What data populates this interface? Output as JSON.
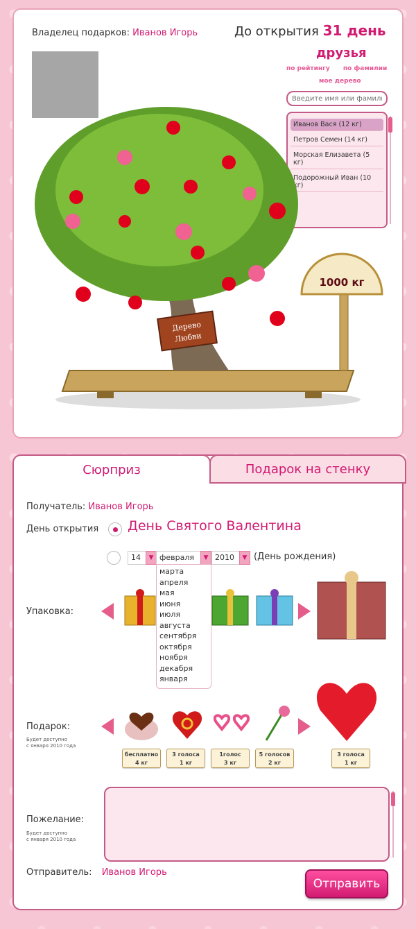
{
  "top": {
    "owner_label": "Владелец подарков:",
    "owner_name": "Иванов Игорь",
    "countdown_label": "До открытия",
    "countdown_value": "31 день",
    "friends": {
      "title": "друзья",
      "sort_by_rating": "по рейтингу",
      "sort_by_surname": "по фамилии",
      "my_tree": "мое дерево",
      "search_placeholder": "Введите имя или фамилию",
      "items": [
        {
          "label": "Иванов Вася (12 кг)",
          "selected": true
        },
        {
          "label": "Петров Семен (14 кг)",
          "selected": false
        },
        {
          "label": "Морская Елизавета (5 кг)",
          "selected": false
        },
        {
          "label": "Подорожный Иван (10 кг)",
          "selected": false
        }
      ]
    },
    "tree": {
      "sign_line1": "Дерево",
      "sign_line2": "Любви",
      "scale_weight": "1000 кг"
    }
  },
  "bottom": {
    "tabs": [
      {
        "label": "Сюрприз",
        "active": true
      },
      {
        "label": "Подарок на стенку",
        "active": false
      }
    ],
    "recipient_label": "Получатель:",
    "recipient_name": "Иванов Игорь",
    "open_day_label": "День открытия",
    "holiday": "День Святого Валентина",
    "date": {
      "day": "14",
      "month": "февраля",
      "year": "2010",
      "note": "(День рождения)",
      "month_options": [
        "марта",
        "апреля",
        "мая",
        "июня",
        "июля",
        "августа",
        "сентября",
        "октября",
        "ноября",
        "декабря",
        "января"
      ]
    },
    "packaging_label": "Упаковка:",
    "gift_label": "Подарок:",
    "gift_note_line1": "Будет доступно",
    "gift_note_line2": "с января  2010 года",
    "gifts": [
      {
        "price": "бесплатно",
        "weight": "4 кг"
      },
      {
        "price": "3 голоса",
        "weight": "1 кг"
      },
      {
        "price": "1голос",
        "weight": "3 кг"
      },
      {
        "price": "5 голосов",
        "weight": "2 кг"
      }
    ],
    "selected_gift": {
      "price": "3 голоса",
      "weight": "1 кг"
    },
    "wish_label": "Пожелание:",
    "wish_note_line1": "Будет доступно",
    "wish_note_line2": "с января  2010 года",
    "sender_label": "Отправитель:",
    "sender_name": "Иванов Игорь",
    "send_button": "Отправить"
  }
}
